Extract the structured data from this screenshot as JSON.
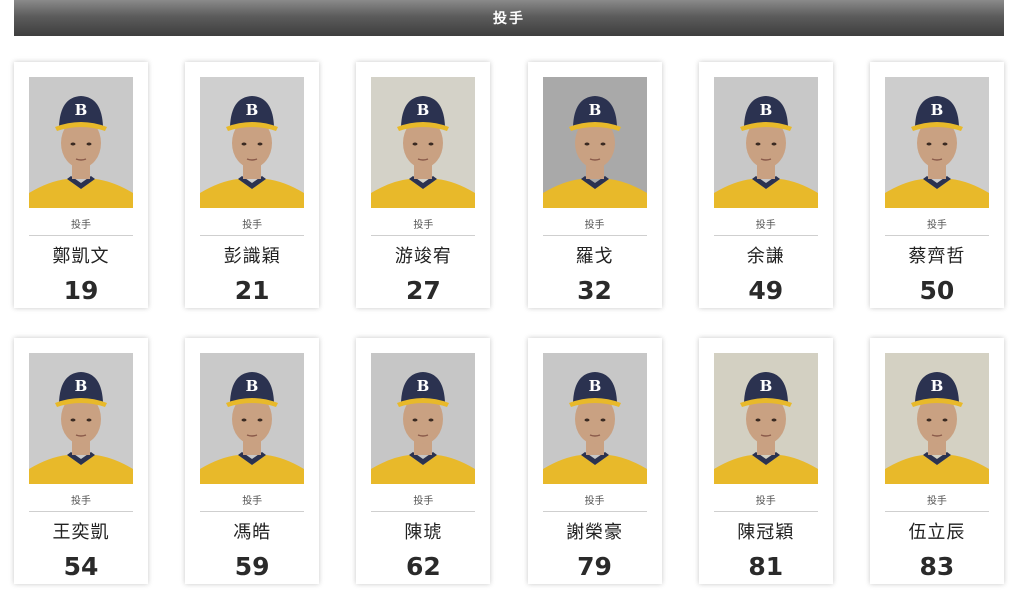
{
  "header": {
    "title": "投手"
  },
  "players": [
    {
      "position": "投手",
      "name": "鄭凱文",
      "number": "19",
      "bg": "#c9c9c9"
    },
    {
      "position": "投手",
      "name": "彭識穎",
      "number": "21",
      "bg": "#cfcfcf"
    },
    {
      "position": "投手",
      "name": "游竣宥",
      "number": "27",
      "bg": "#d4d2c8"
    },
    {
      "position": "投手",
      "name": "羅戈",
      "number": "32",
      "bg": "#a9a9a9"
    },
    {
      "position": "投手",
      "name": "余謙",
      "number": "49",
      "bg": "#c8c8c8"
    },
    {
      "position": "投手",
      "name": "蔡齊哲",
      "number": "50",
      "bg": "#cdcdcd"
    },
    {
      "position": "投手",
      "name": "王奕凱",
      "number": "54",
      "bg": "#cbcbcb"
    },
    {
      "position": "投手",
      "name": "馮皓",
      "number": "59",
      "bg": "#c9c9c9"
    },
    {
      "position": "投手",
      "name": "陳琥",
      "number": "62",
      "bg": "#c6c6c6"
    },
    {
      "position": "投手",
      "name": "謝榮豪",
      "number": "79",
      "bg": "#c7c7c7"
    },
    {
      "position": "投手",
      "name": "陳冠穎",
      "number": "81",
      "bg": "#d3d0c2"
    },
    {
      "position": "投手",
      "name": "伍立辰",
      "number": "83",
      "bg": "#d4d1c3"
    }
  ],
  "colors": {
    "cap": "#2b3250",
    "jersey": "#e8b92a",
    "skin": "#c9a182",
    "cap_logo": "#ffffff"
  }
}
